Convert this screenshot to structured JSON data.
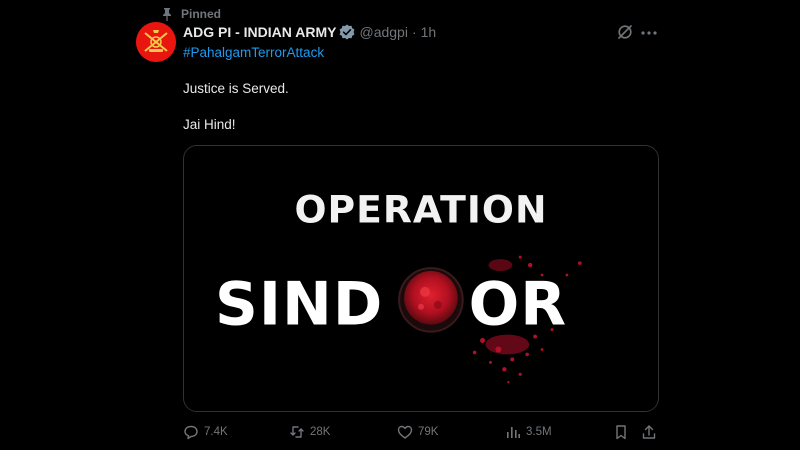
{
  "post": {
    "pinned_label": "Pinned",
    "author_name": "ADG PI - INDIAN ARMY",
    "handle": "@adgpi",
    "separator": "·",
    "time": "1h",
    "hashtag": "#PahalgamTerrorAttack",
    "lines": [
      "Justice is Served.",
      "Jai Hind!"
    ],
    "media": {
      "line1": "OPERATION",
      "line2_left": "SIND",
      "line2_right": "OR"
    },
    "actions": {
      "replies": "7.4K",
      "reposts": "28K",
      "likes": "79K",
      "views": "3.5M"
    }
  },
  "icons": [
    "pin-icon",
    "verified-badge-icon",
    "grok-icon",
    "more-icon",
    "reply-icon",
    "repost-icon",
    "like-icon",
    "views-icon",
    "bookmark-icon",
    "share-icon"
  ],
  "colors": {
    "background": "#000000",
    "text": "#e7e9ea",
    "secondary_text": "#71767b",
    "link": "#1d9bf0",
    "verified": "#829aab",
    "avatar_bg": "#e8160f",
    "sindoor_red": "#c8102e"
  }
}
